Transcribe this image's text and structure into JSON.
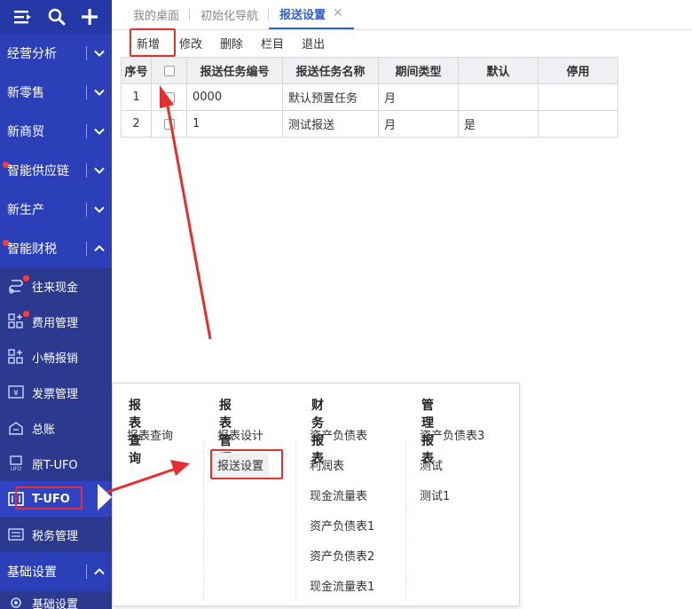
{
  "sidebar": {
    "sections_top": [
      {
        "label": "经营分析",
        "dot": false
      },
      {
        "label": "新零售",
        "dot": false
      },
      {
        "label": "新商贸",
        "dot": false
      },
      {
        "label": "智能供应链",
        "dot": true
      },
      {
        "label": "新生产",
        "dot": false
      },
      {
        "label": "智能财税",
        "dot": true
      }
    ],
    "sub_items": [
      {
        "label": "往来现金",
        "icon": "cash-flow-icon",
        "dot": true
      },
      {
        "label": "费用管理",
        "icon": "expense-grid-icon",
        "dot": true
      },
      {
        "label": "小畅报销",
        "icon": "reimburse-grid-icon",
        "dot": false
      },
      {
        "label": "发票管理",
        "icon": "invoice-icon",
        "dot": false
      },
      {
        "label": "总账",
        "icon": "ledger-icon",
        "dot": false
      },
      {
        "label": "原T-UFO",
        "icon": "ufo-icon",
        "dot": false
      },
      {
        "label": "T-UFO",
        "icon": "t-ufo-icon",
        "dot": false
      },
      {
        "label": "税务管理",
        "icon": "tax-icon",
        "dot": false
      }
    ],
    "section_bottom": {
      "label": "基础设置"
    },
    "partial_item": {
      "label": "基础设置"
    }
  },
  "tabs": [
    {
      "label": "我的桌面"
    },
    {
      "label": "初始化导航"
    },
    {
      "label": "报送设置"
    }
  ],
  "toolbar": {
    "add": "新增",
    "edit": "修改",
    "delete": "删除",
    "columns": "栏目",
    "exit": "退出"
  },
  "table": {
    "headers": [
      "序号",
      "",
      "报送任务编号",
      "报送任务名称",
      "期间类型",
      "默认",
      "停用"
    ],
    "rows": [
      {
        "seq": "1",
        "code": "0000",
        "name": "默认预置任务",
        "period": "月",
        "default": "",
        "disabled": ""
      },
      {
        "seq": "2",
        "code": "1",
        "name": "测试报送",
        "period": "月",
        "default": "是",
        "disabled": ""
      }
    ]
  },
  "popup": {
    "columns": [
      {
        "head": "报表查询",
        "items": [
          "报表查询"
        ]
      },
      {
        "head": "报表管理",
        "items": [
          "报表设计",
          "报送设置"
        ]
      },
      {
        "head": "财务报表",
        "items": [
          "资产负债表",
          "利润表",
          "现金流量表",
          "资产负债表1",
          "资产负债表2",
          "现金流量表1"
        ]
      },
      {
        "head": "管理报表",
        "items": [
          "资产负债表3",
          "测试",
          "测试1"
        ]
      }
    ]
  },
  "colors": {
    "sidebar_bg": "#2a3fb8",
    "accent": "#2f5fd0",
    "highlight": "#e62e2e"
  }
}
